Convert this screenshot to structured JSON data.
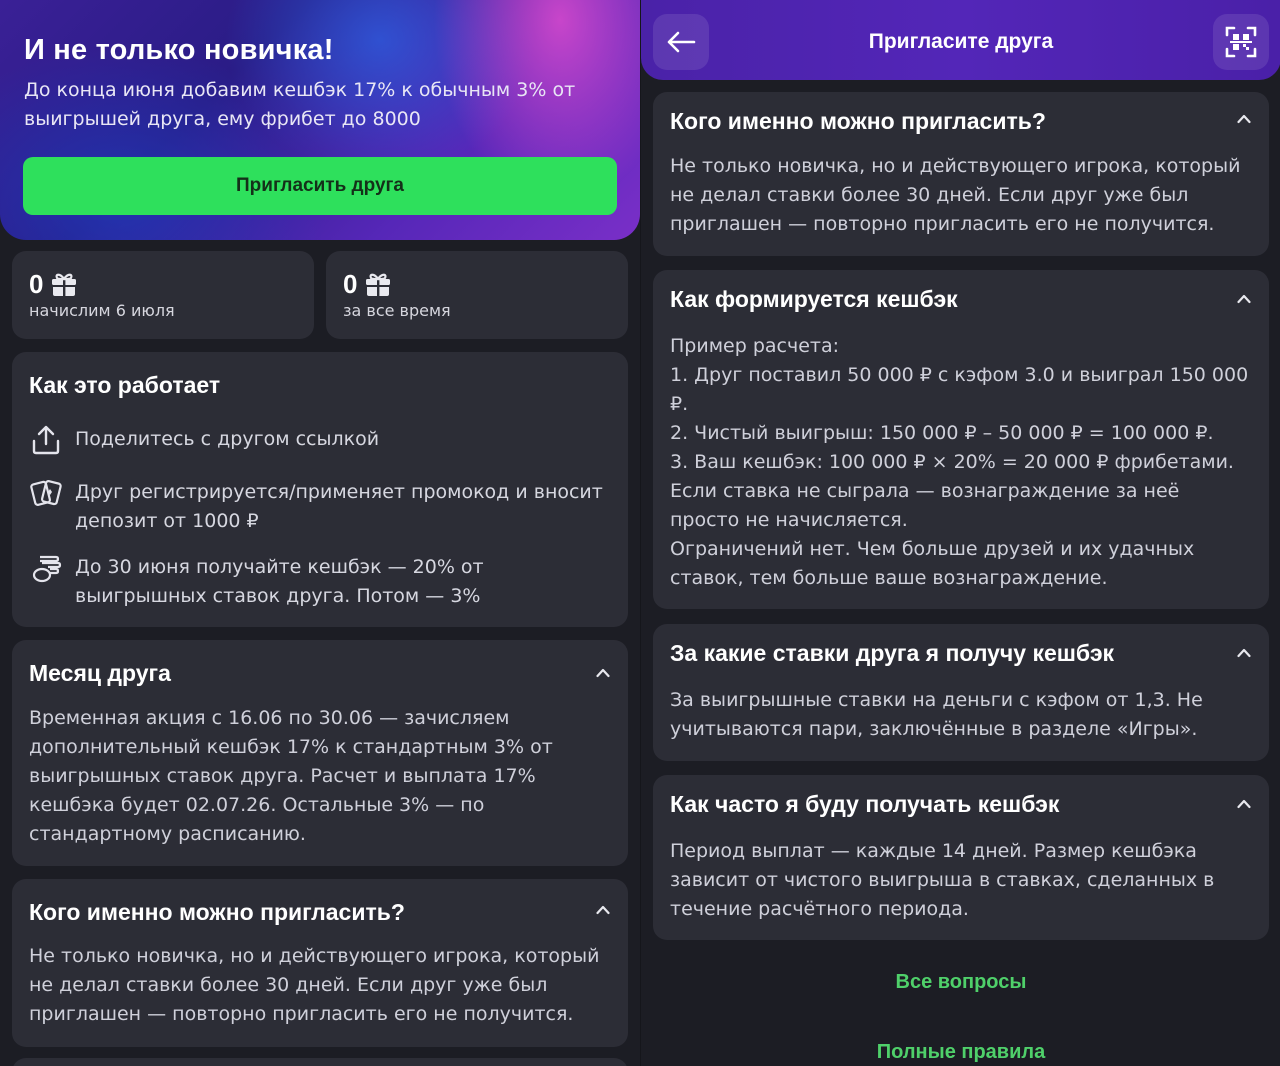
{
  "left": {
    "hero": {
      "title": "И не только новичка!",
      "text": "До конца июня добавим кешбэк 17% к обычным 3% от выигрышей друга, ему фрибет до 8000",
      "button": "Пригласить друга"
    },
    "stats": [
      {
        "value": "0",
        "label": "начислим 6 июля"
      },
      {
        "value": "0",
        "label": "за все время"
      }
    ],
    "how": {
      "title": "Как это работает",
      "steps": [
        {
          "icon": "share-icon",
          "text": "Поделитесь с другом ссылкой"
        },
        {
          "icon": "cards-icon",
          "text": "Друг регистрируется/применяет промокод и вносит депозит от 1000 ₽"
        },
        {
          "icon": "coins-icon",
          "text": "До 30 июня получайте кешбэк — 20% от выигрышных ставок друга. Потом — 3%"
        }
      ]
    },
    "month": {
      "title": "Месяц друга",
      "text": "Временная акция с 16.06 по 30.06 — зачисляем дополнительный кешбэк 17% к стандартным 3% от выигрышных ставок друга. Расчет и выплата 17% кешбэка будет 02.07.26. Остальные 3% — по стандартному расписанию."
    },
    "who": {
      "title": "Кого именно можно пригласить?",
      "text": "Не только новичка, но и действующего игрока, который не делал ставки более 30 дней. Если друг уже был приглашен — повторно пригласить его не получится."
    }
  },
  "right": {
    "header": {
      "title": "Пригласите друга",
      "back_icon": "arrow-left-icon",
      "qr_icon": "qr-scan-icon"
    },
    "faq": [
      {
        "title": "Кого именно можно пригласить?",
        "text": "Не только новичка, но и действующего игрока, который не делал ставки более 30 дней. Если друг уже был приглашен — повторно пригласить его не получится."
      },
      {
        "title": "Как формируется кешбэк",
        "lines": [
          "Пример расчета:",
          "1. Друг поставил 50 000 ₽ с кэфом 3.0 и выиграл 150 000 ₽.",
          "2. Чистый выигрыш: 150 000 ₽ – 50 000 ₽ = 100 000 ₽.",
          "3. Ваш кешбэк: 100 000 ₽ × 20% = 20 000 ₽ фрибетами.",
          "Если ставка не сыграла — вознаграждение за неё просто не начисляется.",
          "Ограничений нет. Чем больше друзей и их удачных ставок, тем больше ваше вознаграждение."
        ]
      },
      {
        "title": "За какие ставки друга я получу кешбэк",
        "text": "За выигрышные ставки на деньги с кэфом от 1,3. Не учитываются пари, заключённые в разделе «Игры»."
      },
      {
        "title": "Как часто я буду получать кешбэк",
        "text": "Период выплат — каждые 14 дней. Размер кешбэка зависит от чистого выигрыша в ставках, сделанных в течение расчётного периода."
      }
    ],
    "links": {
      "all_questions": "Все вопросы",
      "full_rules": "Полные правила"
    }
  },
  "colors": {
    "accent_green": "#2ee05c",
    "link_green": "#4fd06a",
    "card": "#2c2d36",
    "background": "#1c1d24",
    "header_purple": "#5326b8"
  }
}
